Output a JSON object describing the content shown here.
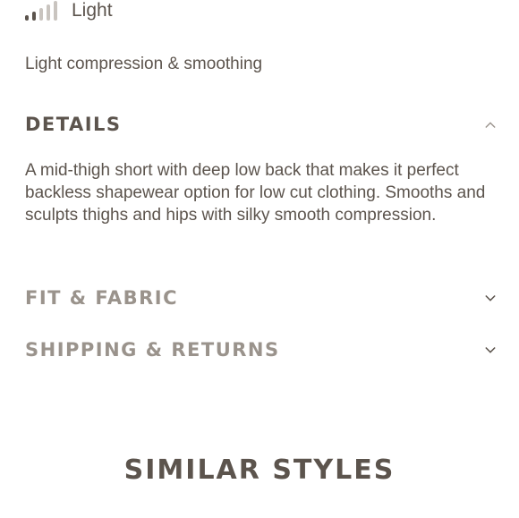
{
  "compression": {
    "level_label": "Light",
    "level_icon": "signal-bars-icon",
    "level_fraction": 0.4,
    "description": "Light compression & smoothing"
  },
  "accordion": {
    "details": {
      "title": "DETAILS",
      "icon": "chevron-up-icon",
      "body": "A mid-thigh short with deep low back that makes it perfect backless shapewear option for low cut clothing. Smooths and sculpts thighs and hips with silky smooth compression."
    },
    "fit_fabric": {
      "title": "FIT & FABRIC",
      "icon": "chevron-down-icon"
    },
    "shipping_returns": {
      "title": "SHIPPING & RETURNS",
      "icon": "chevron-down-icon"
    }
  },
  "similar_styles": {
    "title": "SIMILAR STYLES"
  },
  "colors": {
    "text": "#5c544d",
    "muted": "#9a938c",
    "inactive_bar": "#c9c4bf",
    "background": "#ffffff"
  }
}
